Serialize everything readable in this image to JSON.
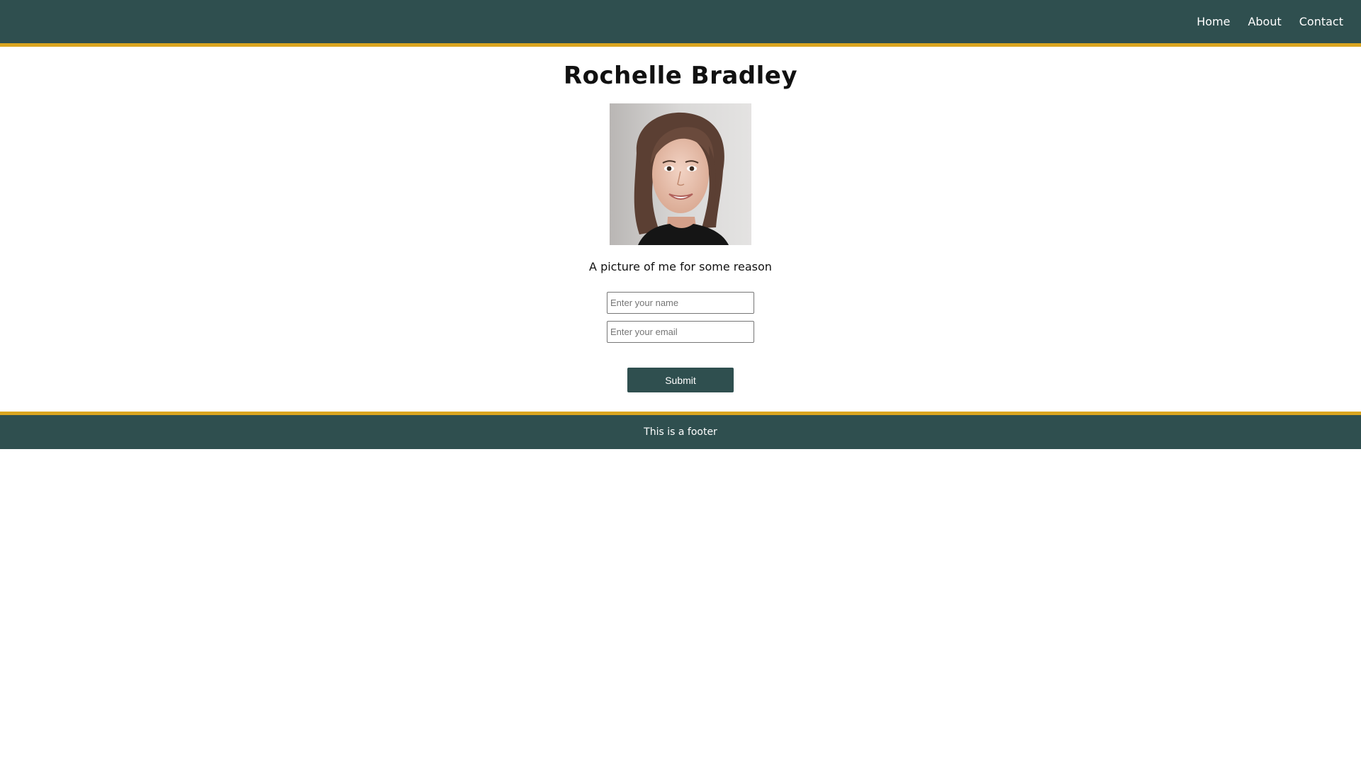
{
  "nav": {
    "items": [
      {
        "label": "Home"
      },
      {
        "label": "About"
      },
      {
        "label": "Contact"
      }
    ]
  },
  "main": {
    "title": "Rochelle Bradley",
    "caption": "A picture of me for some reason",
    "form": {
      "name_placeholder": "Enter your name",
      "email_placeholder": "Enter your email",
      "submit_label": "Submit"
    }
  },
  "footer": {
    "text": "This is a footer"
  },
  "colors": {
    "header_bg": "#2f4f4f",
    "accent_border": "#daa520",
    "button_bg": "#2f4f4f"
  }
}
